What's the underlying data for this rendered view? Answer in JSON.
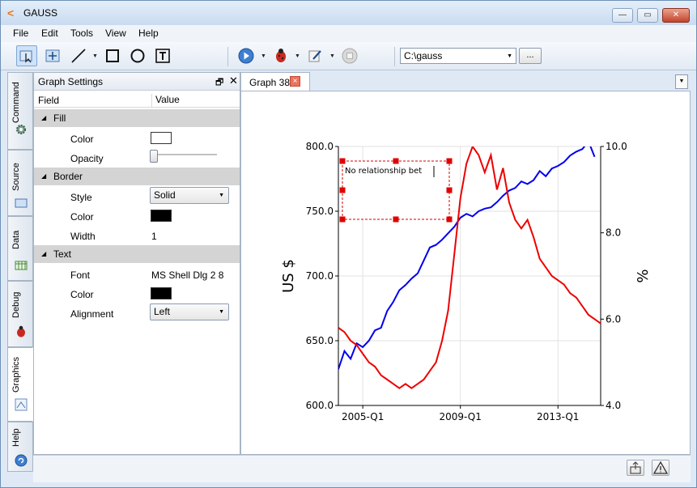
{
  "app": {
    "title": "GAUSS"
  },
  "menu": [
    "File",
    "Edit",
    "Tools",
    "View",
    "Help"
  ],
  "toolbar": {
    "directory": "C:\\gauss",
    "browse_label": "..."
  },
  "side_tabs": [
    "Command",
    "Source",
    "Data",
    "Debug",
    "Graphics",
    "Help"
  ],
  "settings": {
    "title": "Graph Settings",
    "col_field": "Field",
    "col_value": "Value",
    "groups": {
      "fill": "Fill",
      "border": "Border",
      "text": "Text"
    },
    "fill": {
      "color_label": "Color",
      "color": "#ffffff",
      "opacity_label": "Opacity",
      "opacity": 0
    },
    "border": {
      "style_label": "Style",
      "style": "Solid",
      "color_label": "Color",
      "color": "#000000",
      "width_label": "Width",
      "width": "1"
    },
    "text": {
      "font_label": "Font",
      "font": "MS Shell Dlg 2 8",
      "color_label": "Color",
      "color": "#000000",
      "align_label": "Alignment",
      "align": "Left"
    }
  },
  "graph_tab": {
    "label": "Graph 38",
    "close": "×"
  },
  "chart_data": {
    "type": "line",
    "title": "",
    "xlabel": "",
    "ylabel": "US $",
    "ylabel_right": "%",
    "x_ticks": [
      "2005-Q1",
      "2009-Q1",
      "2013-Q1"
    ],
    "y_ticks": [
      "600.0",
      "650.0",
      "700.0",
      "750.0",
      "800.0"
    ],
    "y2_ticks": [
      "4.0",
      "6.0",
      "8.0",
      "10.0"
    ],
    "ylim": [
      600,
      800
    ],
    "y2lim": [
      4,
      10
    ],
    "xlim": [
      2004.0,
      2014.75
    ],
    "grid": true,
    "annotation": "No relationship bet",
    "colors": {
      "left": "#0000ee",
      "right": "#ee0000"
    },
    "series": [
      {
        "axis": "left",
        "color": "#0000ee",
        "x": [
          2004.0,
          2004.25,
          2004.5,
          2004.75,
          2005.0,
          2005.25,
          2005.5,
          2005.75,
          2006.0,
          2006.25,
          2006.5,
          2006.75,
          2007.0,
          2007.25,
          2007.5,
          2007.75,
          2008.0,
          2008.25,
          2008.5,
          2008.75,
          2009.0,
          2009.25,
          2009.5,
          2009.75,
          2010.0,
          2010.25,
          2010.5,
          2010.75,
          2011.0,
          2011.25,
          2011.5,
          2011.75,
          2012.0,
          2012.25,
          2012.5,
          2012.75,
          2013.0,
          2013.25,
          2013.5,
          2013.75,
          2014.0,
          2014.25,
          2014.5
        ],
        "values": [
          628,
          642,
          636,
          648,
          645,
          650,
          658,
          660,
          673,
          680,
          689,
          693,
          698,
          702,
          712,
          722,
          724,
          728,
          733,
          738,
          745,
          748,
          746,
          750,
          752,
          753,
          757,
          762,
          766,
          768,
          773,
          771,
          774,
          781,
          777,
          783,
          785,
          788,
          793,
          796,
          798,
          804,
          792
        ]
      },
      {
        "axis": "right",
        "color": "#ee0000",
        "x": [
          2004.0,
          2004.25,
          2004.5,
          2004.75,
          2005.0,
          2005.25,
          2005.5,
          2005.75,
          2006.0,
          2006.25,
          2006.5,
          2006.75,
          2007.0,
          2007.25,
          2007.5,
          2007.75,
          2008.0,
          2008.25,
          2008.5,
          2008.75,
          2009.0,
          2009.25,
          2009.5,
          2009.75,
          2010.0,
          2010.25,
          2010.5,
          2010.75,
          2011.0,
          2011.25,
          2011.5,
          2011.75,
          2012.0,
          2012.25,
          2012.5,
          2012.75,
          2013.0,
          2013.25,
          2013.5,
          2013.75,
          2014.0,
          2014.25,
          2014.5,
          2014.75
        ],
        "values": [
          5.8,
          5.7,
          5.5,
          5.4,
          5.2,
          5.0,
          4.9,
          4.7,
          4.6,
          4.5,
          4.4,
          4.5,
          4.4,
          4.5,
          4.6,
          4.8,
          5.0,
          5.5,
          6.2,
          7.5,
          8.8,
          9.6,
          10.0,
          9.8,
          9.4,
          9.8,
          9.0,
          9.5,
          8.7,
          8.3,
          8.1,
          8.3,
          7.9,
          7.4,
          7.2,
          7.0,
          6.9,
          6.8,
          6.6,
          6.5,
          6.3,
          6.1,
          6.0,
          5.9
        ]
      }
    ]
  }
}
